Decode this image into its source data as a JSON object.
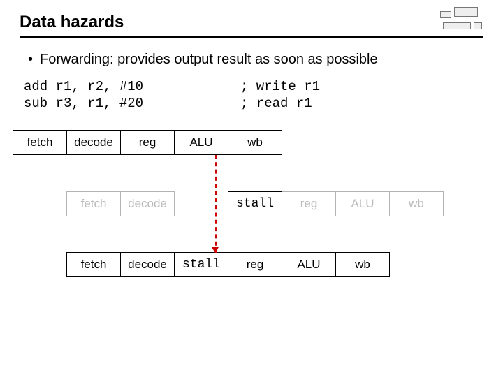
{
  "title": "Data hazards",
  "bullet": "Forwarding: provides output result as soon as possible",
  "code": {
    "rows": [
      {
        "left": "add r1, r2, #10",
        "right": "; write r1"
      },
      {
        "left": "sub r3, r1, #20",
        "right": "; read r1"
      }
    ]
  },
  "stages": {
    "fetch": "fetch",
    "decode": "decode",
    "reg": "reg",
    "alu": "ALU",
    "wb": "wb",
    "stall": "stall"
  }
}
